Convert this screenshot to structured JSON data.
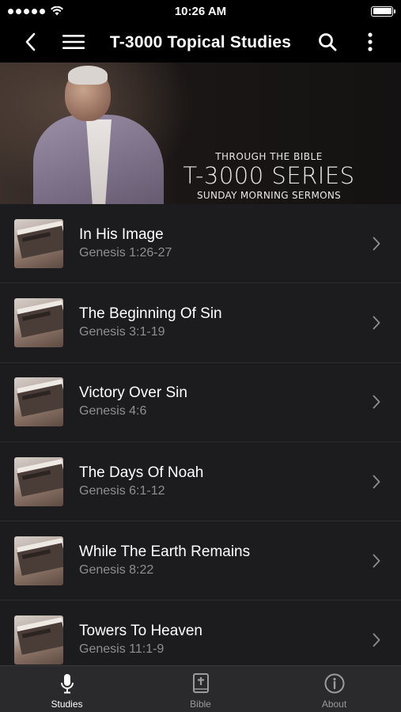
{
  "status": {
    "time": "10:26 AM"
  },
  "nav": {
    "title": "T-3000 Topical Studies",
    "back_icon": "chevron-left-icon",
    "menu_icon": "hamburger-menu-icon",
    "search_icon": "search-icon",
    "more_icon": "more-vertical-icon"
  },
  "banner": {
    "line1": "THROUGH THE BIBLE",
    "line2": "T-3000 SERIES",
    "line3": "SUNDAY MORNING SERMONS"
  },
  "studies": [
    {
      "title": "In His Image",
      "reference": "Genesis 1:26-27"
    },
    {
      "title": "The Beginning Of Sin",
      "reference": "Genesis 3:1-19"
    },
    {
      "title": "Victory Over Sin",
      "reference": "Genesis 4:6"
    },
    {
      "title": "The Days Of Noah",
      "reference": "Genesis 6:1-12"
    },
    {
      "title": "While The Earth Remains",
      "reference": "Genesis 8:22"
    },
    {
      "title": "Towers To Heaven",
      "reference": "Genesis 11:1-9"
    }
  ],
  "tabs": [
    {
      "label": "Studies",
      "icon": "microphone-icon",
      "active": true
    },
    {
      "label": "Bible",
      "icon": "bible-icon",
      "active": false
    },
    {
      "label": "About",
      "icon": "info-icon",
      "active": false
    }
  ],
  "colors": {
    "background": "#1c1c1e",
    "bar": "#000000",
    "tabbar": "#2a2a2c",
    "subtitle": "#8e8e93"
  }
}
